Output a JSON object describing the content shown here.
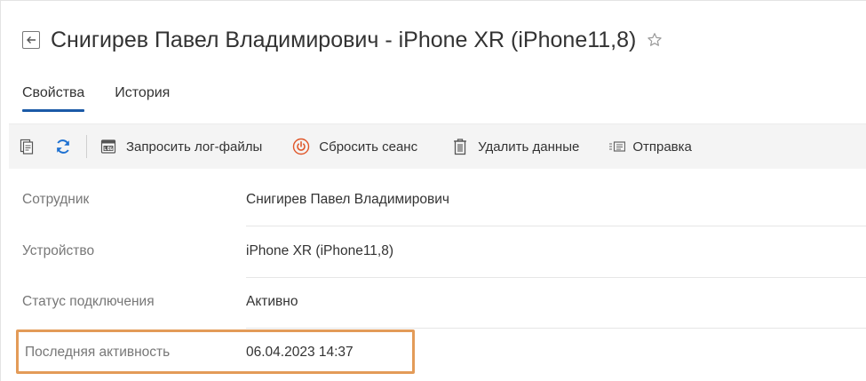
{
  "header": {
    "title": "Снигирев Павел Владимирович - iPhone XR (iPhone11,8)"
  },
  "tabs": [
    {
      "label": "Свойства",
      "active": true
    },
    {
      "label": "История",
      "active": false
    }
  ],
  "toolbar": {
    "request_logs_label": "Запросить лог-файлы",
    "reset_session_label": "Сбросить сеанс",
    "delete_data_label": "Удалить данные",
    "send_label": "Отправка"
  },
  "fields": [
    {
      "label": "Сотрудник",
      "value": "Снигирев Павел Владимирович"
    },
    {
      "label": "Устройство",
      "value": "iPhone XR (iPhone11,8)"
    },
    {
      "label": "Статус подключения",
      "value": "Активно"
    },
    {
      "label": "Последняя активность",
      "value": "06.04.2023 14:37"
    }
  ],
  "colors": {
    "accent": "#1b5aa7",
    "highlight": "#e39b58",
    "toolbar_bg": "#f4f4f4",
    "power_icon": "#e0582b"
  }
}
